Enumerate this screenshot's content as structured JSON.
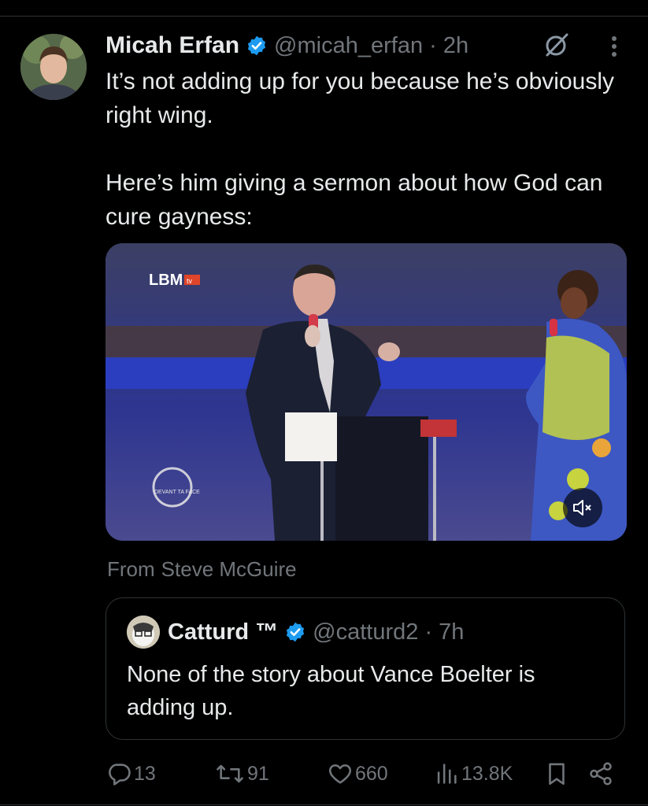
{
  "tweet": {
    "author_name": "Micah Erfan",
    "meta": "@micah_erfan · 2h",
    "text": "It’s not adding up for you because he’s obviously right wing.\n\nHere’s him giving a sermon about how God can cure gayness:"
  },
  "media": {
    "channel_logo": "LBM",
    "channel_logo_sub": "tv",
    "watermark": "DEVANT TA FACE",
    "mute_icon": "speaker-muted-icon"
  },
  "source": {
    "prefix": "From",
    "name": "Steve McGuire"
  },
  "quoted": {
    "author_name": "Catturd ™",
    "meta": "@catturd2 · 7h",
    "text": "None of the story about Vance Boelter is adding up."
  },
  "actions": {
    "replies": "13",
    "reposts": "91",
    "likes": "660",
    "views": "13.8K"
  },
  "colors": {
    "background": "#000000",
    "text": "#e7e9ea",
    "muted": "#71767b",
    "verified": "#1d9bf0",
    "border": "#2f3336"
  }
}
